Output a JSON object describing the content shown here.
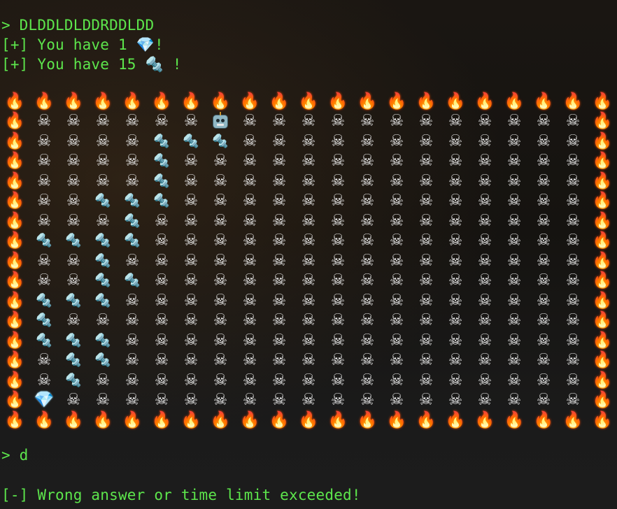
{
  "terminal": {
    "command_line": "> DLDDLDLDDRDDLDD",
    "gems_line": {
      "prefix": "[+] You have 1 ",
      "icon": "💎",
      "suffix": "!"
    },
    "bolts_line": {
      "prefix": "[+] You have 15 ",
      "icon": "🔩",
      "suffix": " !"
    },
    "input_line": "> d",
    "error_line": "[-] Wrong answer or time limit exceeded!"
  },
  "legend": {
    "F": {
      "name": "fire-tile",
      "glyph": "🔥"
    },
    "S": {
      "name": "skull-tile",
      "glyph": "☠"
    },
    "B": {
      "name": "bolt-tile",
      "glyph": "🔩"
    },
    "G": {
      "name": "gem-tile",
      "glyph": "💎"
    },
    "R": {
      "name": "robot-player",
      "glyph": ""
    }
  },
  "grid": {
    "columns": 21,
    "rows": [
      "FFFFFFFFFFFFFFFFFFFFF",
      "FSSSSSSRSSSSSSSSSSSSF",
      "FSSSSBBBSSSSSSSSSSSSF",
      "FSSSSBSSSSSSSSSSSSSSF",
      "FSSSSBSSSSSSSSSSSSSSF",
      "FSSBBBSSSSSSSSSSSSSSF",
      "FSSSBSSSSSSSSSSSSSSSF",
      "FBBBBSSSSSSSSSSSSSSSF",
      "FSSBSSSSSSSSSSSSSSSSF",
      "FSSBBSSSSSSSSSSSSSSSF",
      "FBBBSSSSSSSSSSSSSSSSF",
      "FBSSSSSSSSSSSSSSSSSSF",
      "FBBBSSSSSSSSSSSSSSSSF",
      "FSBBSSSSSSSSSSSSSSSSF",
      "FSBSSSSSSSSSSSSSSSSSF",
      "FGSSSSSSSSSSSSSSSSSSF",
      "FFFFFFFFFFFFFFFFFFFFF"
    ]
  }
}
